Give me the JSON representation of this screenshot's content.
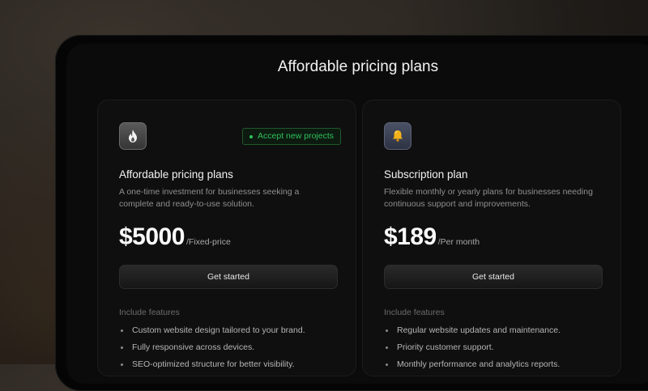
{
  "page": {
    "heading": "Affordable pricing plans"
  },
  "plans": [
    {
      "icon": "flame-icon",
      "badge": "Accept new projects",
      "name": "Affordable pricing plans",
      "description": "A one-time investment for businesses seeking a complete and ready-to-use solution.",
      "price": "$5000",
      "price_unit": "/Fixed-price",
      "cta": "Get started",
      "features_heading": "Include features",
      "features": [
        "Custom website design tailored to your brand.",
        "Fully responsive across devices.",
        "SEO-optimized structure for better visibility."
      ]
    },
    {
      "icon": "bell-icon",
      "name": "Subscription plan",
      "description": "Flexible monthly or yearly plans for businesses needing continuous support and improvements.",
      "price": "$189",
      "price_unit": "/Per month",
      "cta": "Get started",
      "features_heading": "Include features",
      "features": [
        "Regular website updates and maintenance.",
        "Priority customer support.",
        "Monthly performance and analytics reports."
      ]
    }
  ],
  "colors": {
    "accent_green": "#2fc15a",
    "card_bg": "#0f0f0f",
    "page_bg": "#0b0b0b"
  }
}
